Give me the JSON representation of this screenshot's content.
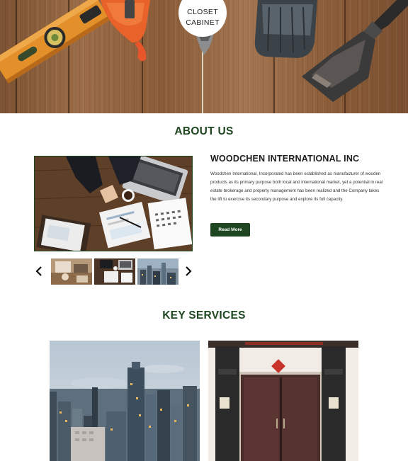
{
  "brand": {
    "line1": "CLOSET",
    "line2": "CABINET"
  },
  "about": {
    "heading": "ABOUT US",
    "company_name": "WOODCHEN INTERNATIONAL INC",
    "description": "Woodchen International, Incorporated has been established as manufacturer of wooden products as its primary purpose both local and international market, yet a potential in real estate brokerage and property management has been realized and the Company takes the lift to exercise its secondary purpose and explore its full capacity.",
    "read_more_label": "Read More",
    "carousel": {
      "prev_icon": "chevron-left-icon",
      "next_icon": "chevron-right-icon",
      "thumbnails": [
        "thumbnail-desk",
        "thumbnail-office",
        "thumbnail-city"
      ]
    }
  },
  "services": {
    "heading": "KEY SERVICES",
    "cards": [
      "service-city-skyline",
      "service-wooden-door"
    ]
  },
  "colors": {
    "brand_green": "#1e4620",
    "text_dark": "#1b1b1b",
    "wood": "#8a5c38"
  }
}
